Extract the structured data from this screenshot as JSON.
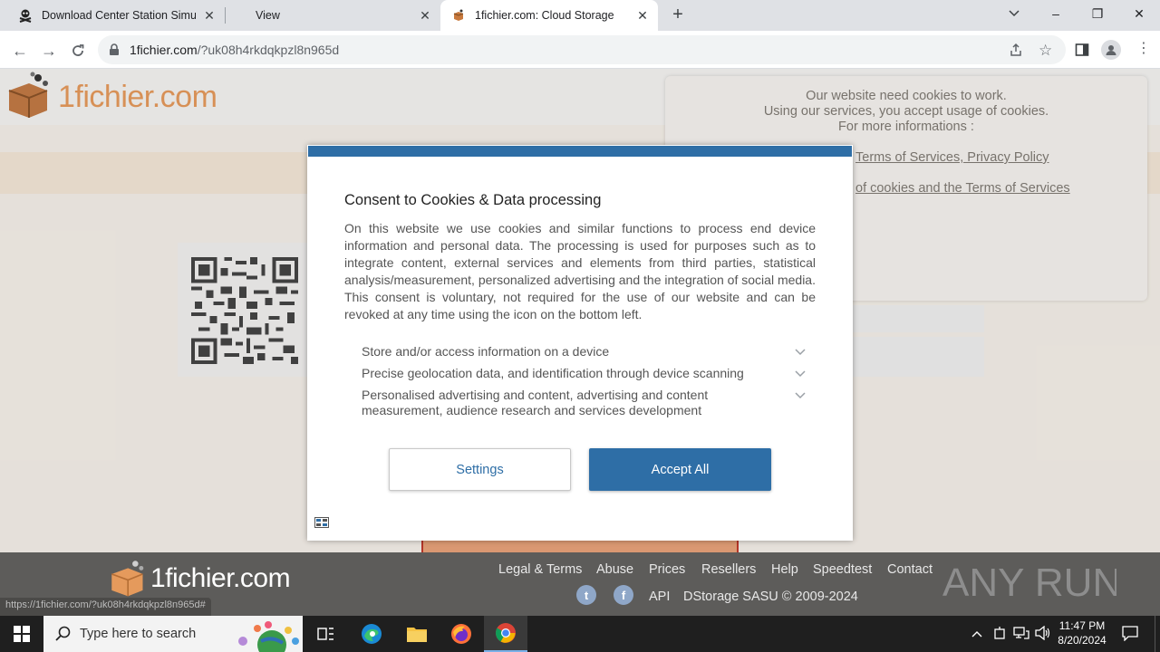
{
  "browser": {
    "tabs": [
      {
        "label": "Download Center Station Simula",
        "icon": "skull-crossbones-icon",
        "active": false
      },
      {
        "label": "View",
        "icon": "",
        "active": false
      },
      {
        "label": "1fichier.com: Cloud Storage",
        "icon": "1fichier-favicon",
        "active": true
      }
    ],
    "new_tab": "+",
    "url_host": "1fichier.com",
    "url_path": "/?uk08h4rkdqkpzl8n965d",
    "window_controls": {
      "minimize": "–",
      "maximize": "❐",
      "close": "✕",
      "tab_search": "⌄"
    }
  },
  "site": {
    "logo_text": "1fichier.com",
    "cookie_note": {
      "line1": "Our website need cookies to work.",
      "line2": "Using our services, you accept usage of cookies.",
      "line3": "For more informations :",
      "link1": "Terms of Services, Privacy Policy",
      "link2": "of cookies and the Terms of Services"
    }
  },
  "consent": {
    "title": "Consent to Cookies & Data processing",
    "body": "On this website we use cookies and similar functions to process end device information and personal data. The processing is used for purposes such as to integrate content, external services and elements from third parties, statistical analysis/measurement, personalized advertising and the integration of social media. This consent is voluntary, not required for the use of our website and can be revoked at any time using the icon on the bottom left.",
    "purposes": [
      "Store and/or access information on a device",
      "Precise geolocation data, and identification through device scanning",
      "Personalised advertising and content, advertising and content measurement, audience research and services development"
    ],
    "settings_label": "Settings",
    "accept_label": "Accept All"
  },
  "footer": {
    "logo_text": "1fichier.com",
    "nav": [
      "Legal & Terms",
      "Abuse",
      "Prices",
      "Resellers",
      "Help",
      "Speedtest",
      "Contact"
    ],
    "api": "API",
    "copyright": "DStorage SASU © 2009-2024",
    "watermark": "ANY RUN",
    "status_url": "https://1fichier.com/?uk08h4rkdqkpzl8n965d#"
  },
  "taskbar": {
    "search_placeholder": "Type here to search",
    "time": "11:47 PM",
    "date": "8/20/2024"
  },
  "colors": {
    "accent_blue": "#2e6ea6",
    "logo_orange": "#e58a3c",
    "footer_bg": "#5d5c5a"
  }
}
